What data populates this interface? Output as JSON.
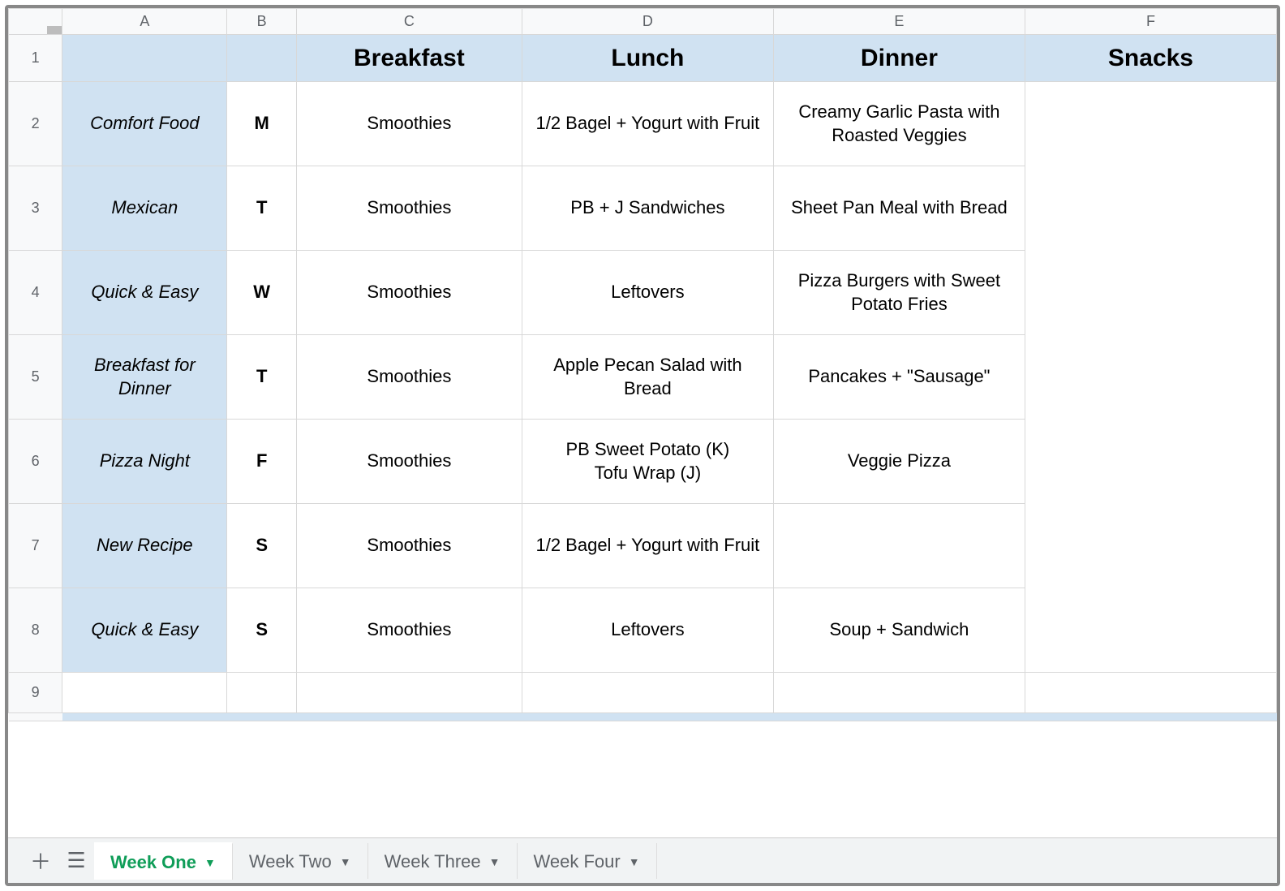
{
  "columns": [
    "A",
    "B",
    "C",
    "D",
    "E",
    "F"
  ],
  "rowNumbers": [
    "1",
    "2",
    "3",
    "4",
    "5",
    "6",
    "7",
    "8",
    "9"
  ],
  "headerRow": {
    "breakfast": "Breakfast",
    "lunch": "Lunch",
    "dinner": "Dinner",
    "snacks": "Snacks"
  },
  "rows": [
    {
      "theme": "Comfort Food",
      "day": "M",
      "breakfast": "Smoothies",
      "lunch": "1/2 Bagel + Yogurt with Fruit",
      "dinner": "Creamy Garlic Pasta with Roasted Veggies",
      "snacks": ""
    },
    {
      "theme": "Mexican",
      "day": "T",
      "breakfast": "Smoothies",
      "lunch": "PB + J Sandwiches",
      "dinner": "Sheet Pan Meal with Bread",
      "snacks": ""
    },
    {
      "theme": "Quick & Easy",
      "day": "W",
      "breakfast": "Smoothies",
      "lunch": "Leftovers",
      "dinner": "Pizza Burgers with Sweet Potato Fries",
      "snacks": ""
    },
    {
      "theme": "Breakfast for Dinner",
      "day": "T",
      "breakfast": "Smoothies",
      "lunch": "Apple Pecan Salad with Bread",
      "dinner": "Pancakes + \"Sausage\"",
      "snacks": ""
    },
    {
      "theme": "Pizza Night",
      "day": "F",
      "breakfast": "Smoothies",
      "lunch": "PB Sweet Potato (K)\nTofu Wrap (J)",
      "dinner": "Veggie Pizza",
      "snacks": ""
    },
    {
      "theme": "New Recipe",
      "day": "S",
      "breakfast": "Smoothies",
      "lunch": "1/2 Bagel + Yogurt with Fruit",
      "dinner": "",
      "snacks": ""
    },
    {
      "theme": "Quick & Easy",
      "day": "S",
      "breakfast": "Smoothies",
      "lunch": "Leftovers",
      "dinner": "Soup + Sandwich",
      "snacks": ""
    }
  ],
  "tabs": {
    "active": "Week One",
    "others": [
      "Week Two",
      "Week Three",
      "Week Four"
    ]
  }
}
